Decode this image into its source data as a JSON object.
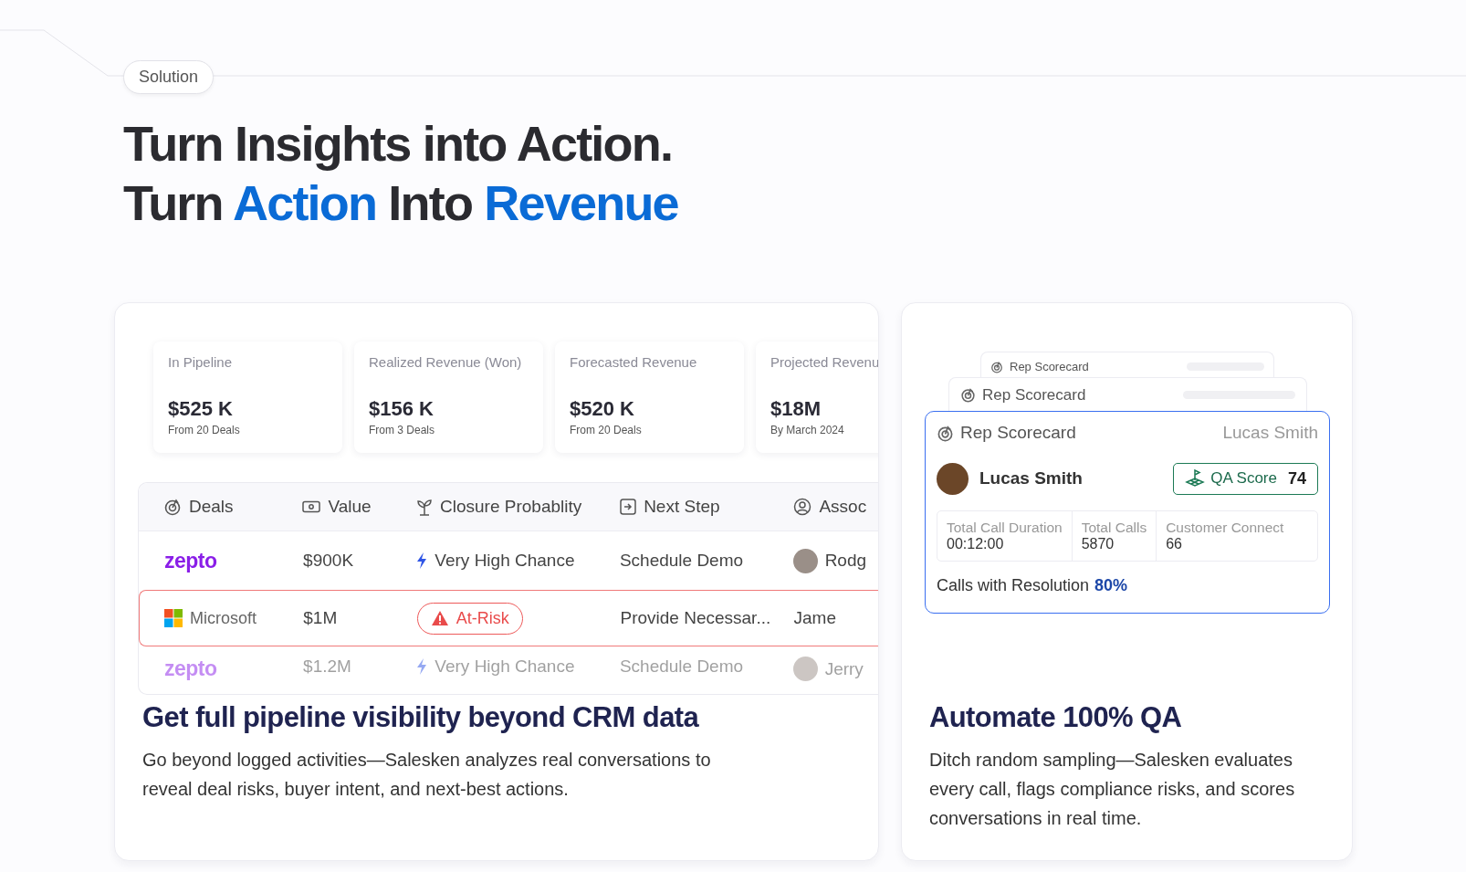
{
  "section_tag": "Solution",
  "headline": [
    [
      {
        "text": "Turn Insights into Action.",
        "highlight": false
      }
    ],
    [
      {
        "text": "Turn ",
        "highlight": false
      },
      {
        "text": "Action",
        "highlight": true
      },
      {
        "text": " Into ",
        "highlight": false
      },
      {
        "text": "Revenue",
        "highlight": true
      }
    ]
  ],
  "pipeline_card": {
    "metrics": [
      {
        "label": "In Pipeline",
        "value": "$525 K",
        "note": "From 20 Deals"
      },
      {
        "label": "Realized Revenue (Won)",
        "value": "$156 K",
        "note": "From 3 Deals"
      },
      {
        "label": "Forecasted Revenue",
        "value": "$520 K",
        "note": "From 20 Deals"
      },
      {
        "label": "Projected Revenu",
        "value": "$18M",
        "note": "By March 2024"
      }
    ],
    "table": {
      "columns": [
        {
          "label": "Deals",
          "kind": "deals"
        },
        {
          "label": "Value",
          "kind": "value"
        },
        {
          "label": "Closure Probablity",
          "kind": "closure"
        },
        {
          "label": "Next Step",
          "kind": "next"
        },
        {
          "label": "Assoc",
          "kind": "person"
        }
      ],
      "rows": [
        {
          "company": {
            "name": "zepto",
            "kind": "wordmark"
          },
          "value": "$900K",
          "closure": {
            "text": "Very High Chance",
            "kind": "chance"
          },
          "next_step": "Schedule Demo",
          "person": "Rodg",
          "at_risk": false,
          "faded": false
        },
        {
          "company": {
            "name": "Microsoft",
            "kind": "squares"
          },
          "value": "$1M",
          "closure": {
            "text": "At-Risk",
            "kind": "risk"
          },
          "next_step": "Provide Necessar...",
          "person": "Jame",
          "at_risk": true,
          "faded": false
        },
        {
          "company": {
            "name": "zepto",
            "kind": "wordmark"
          },
          "value": "$1.2M",
          "closure": {
            "text": "Very High Chance",
            "kind": "chance"
          },
          "next_step": "Schedule Demo",
          "person": "Jerry",
          "at_risk": false,
          "faded": true
        }
      ]
    },
    "title": "Get full pipeline visibility beyond CRM data",
    "description": "Go beyond logged activities—Salesken analyzes real conversations to reveal deal risks, buyer intent, and next-best actions."
  },
  "qa_card": {
    "back_cards": [
      "Rep Scorecard",
      "Rep Scorecard"
    ],
    "scorecard": {
      "title": "Rep Scorecard",
      "rep_label": "Lucas Smith",
      "rep_name": "Lucas Smith",
      "qa_label": "QA Score",
      "qa_value": "74",
      "stats": [
        {
          "label": "Total Call Duration",
          "value": "00:12:00"
        },
        {
          "label": "Total Calls",
          "value": "5870"
        },
        {
          "label": "Customer Connect",
          "value": "66"
        }
      ],
      "resolution_label": "Calls with Resolution",
      "resolution_value": "80%"
    },
    "title": "Automate 100% QA",
    "description": "Ditch random sampling—Salesken evaluates every call, flags compliance risks, and scores conversations in real time."
  }
}
